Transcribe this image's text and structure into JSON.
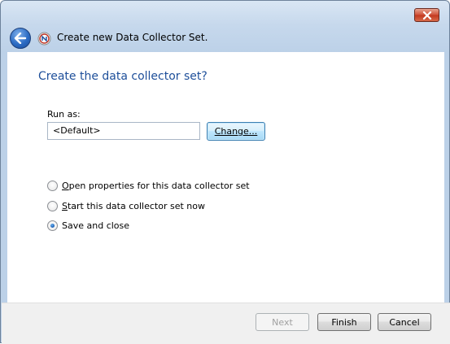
{
  "window": {
    "title": "Create new Data Collector Set."
  },
  "page": {
    "heading": "Create the data collector set?"
  },
  "run_as": {
    "label": "Run as:",
    "value": "<Default>",
    "change_button": "Change..."
  },
  "options": [
    {
      "label": "Open properties for this data collector set",
      "checked": false
    },
    {
      "label": "Start this data collector set now",
      "checked": false
    },
    {
      "label": "Save and close",
      "checked": true
    }
  ],
  "footer": {
    "next_label": "Next",
    "finish_label": "Finish",
    "cancel_label": "Cancel"
  },
  "icons": {
    "close": "close-icon",
    "back": "back-arrow-icon",
    "app": "performance-monitor-icon"
  }
}
